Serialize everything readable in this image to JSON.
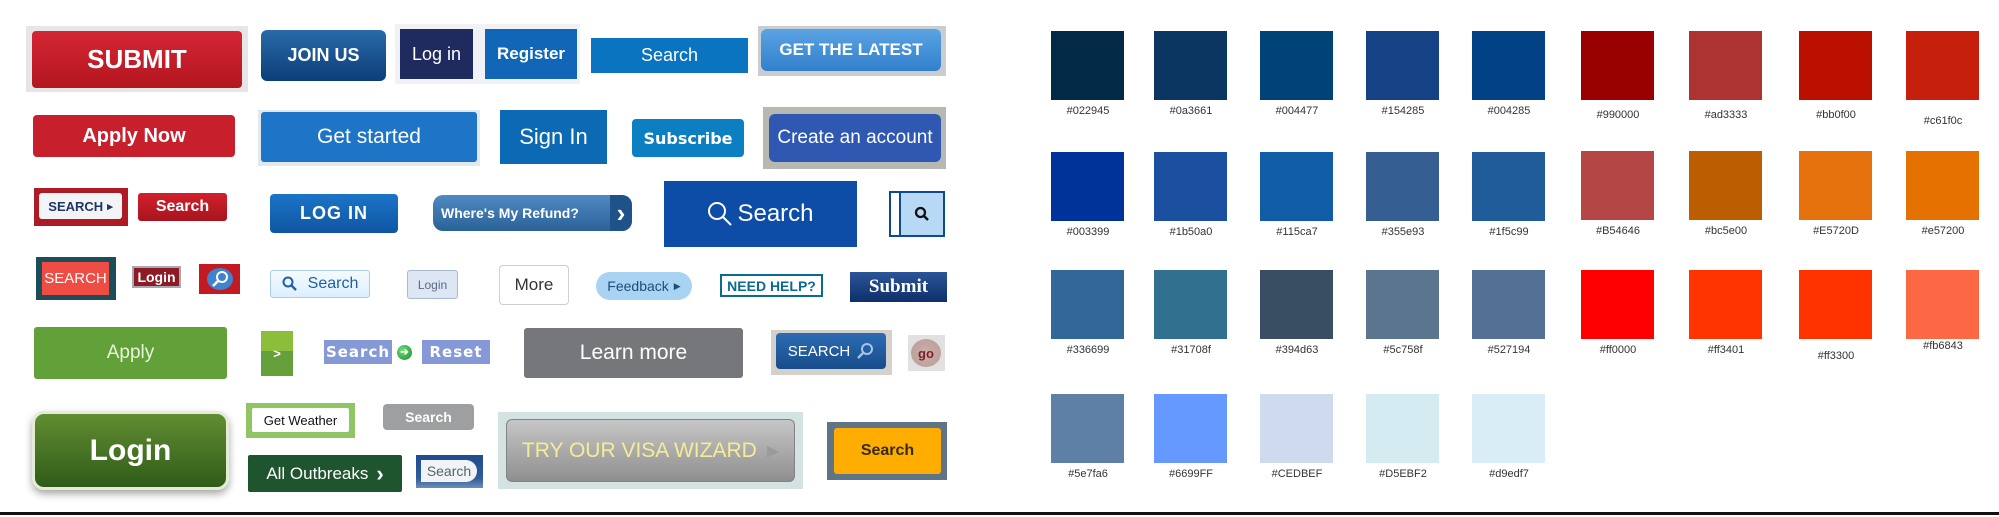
{
  "buttons": {
    "submit_red": "SUBMIT",
    "join_us": "JOIN US",
    "log_in_navy": "Log in",
    "register": "Register",
    "search_blue_flat": "Search",
    "get_the_latest": "GET THE LATEST",
    "apply_now": "Apply Now",
    "get_started": "Get started",
    "sign_in": "Sign In",
    "subscribe": "Subscribe",
    "create_account": "Create an account",
    "search_framed_red": "SEARCH",
    "search_red": "Search",
    "log_in_caps": "LOG IN",
    "wheres_my_refund": "Where's My Refund?",
    "search_large": "Search",
    "search_coral": "SEARCH",
    "login_maroon": "Login",
    "search_light": "Search",
    "login_light": "Login",
    "more": "More",
    "feedback": "Feedback",
    "need_help": "NEED HELP?",
    "submit_serif": "Submit",
    "apply_green": "Apply",
    "green_arrow": ">",
    "search_lavender": "Search",
    "reset_lavender": "Reset",
    "learn_more": "Learn more",
    "search_blue_icon": "SEARCH",
    "go": "go",
    "login_green_large": "Login",
    "get_weather": "Get Weather",
    "search_gray": "Search",
    "all_outbreaks": "All Outbreaks",
    "search_pill": "Search",
    "visa_wizard": "TRY OUR VISA WIZARD",
    "search_yellow": "Search"
  },
  "icons": {
    "chevron_right": "›",
    "triangle_right": "▸",
    "play_triangle": "▶"
  },
  "palette": {
    "blues": [
      {
        "hex": "#022945",
        "label": "#022945"
      },
      {
        "hex": "#0a3661",
        "label": "#0a3661"
      },
      {
        "hex": "#004477",
        "label": "#004477"
      },
      {
        "hex": "#154285",
        "label": "#154285"
      },
      {
        "hex": "#004285",
        "label": "#004285"
      },
      {
        "hex": "#003399",
        "label": "#003399"
      },
      {
        "hex": "#1b50a0",
        "label": "#1b50a0"
      },
      {
        "hex": "#115ca7",
        "label": "#115ca7"
      },
      {
        "hex": "#355e93",
        "label": "#355e93"
      },
      {
        "hex": "#1f5c99",
        "label": "#1f5c99"
      },
      {
        "hex": "#336699",
        "label": "#336699"
      },
      {
        "hex": "#31708f",
        "label": "#31708f"
      },
      {
        "hex": "#394d63",
        "label": "#394d63"
      },
      {
        "hex": "#5c758f",
        "label": "#5c758f"
      },
      {
        "hex": "#527194",
        "label": "#527194"
      },
      {
        "hex": "#5e7fa6",
        "label": "#5e7fa6"
      },
      {
        "hex": "#6699FF",
        "label": "#6699FF"
      },
      {
        "hex": "#CEDBEF",
        "label": "#CEDBEF"
      },
      {
        "hex": "#D5EBF2",
        "label": "#D5EBF2"
      },
      {
        "hex": "#d9edf7",
        "label": "#d9edf7"
      }
    ],
    "reds": [
      {
        "hex": "#990000",
        "label": "#990000"
      },
      {
        "hex": "#ad3333",
        "label": "#ad3333"
      },
      {
        "hex": "#bb0f00",
        "label": "#bb0f00"
      },
      {
        "hex": "#c61f0c",
        "label": "#c61f0c"
      },
      {
        "hex": "#B54646",
        "label": "#B54646"
      },
      {
        "hex": "#bc5e00",
        "label": "#bc5e00"
      },
      {
        "hex": "#E5720D",
        "label": "#E5720D"
      },
      {
        "hex": "#e57200",
        "label": "#e57200"
      },
      {
        "hex": "#ff0000",
        "label": "#ff0000"
      },
      {
        "hex": "#ff3401",
        "label": "#ff3401"
      },
      {
        "hex": "#ff3300",
        "label": "#ff3300"
      },
      {
        "hex": "#fb6843",
        "label": "#fb6843"
      }
    ]
  }
}
